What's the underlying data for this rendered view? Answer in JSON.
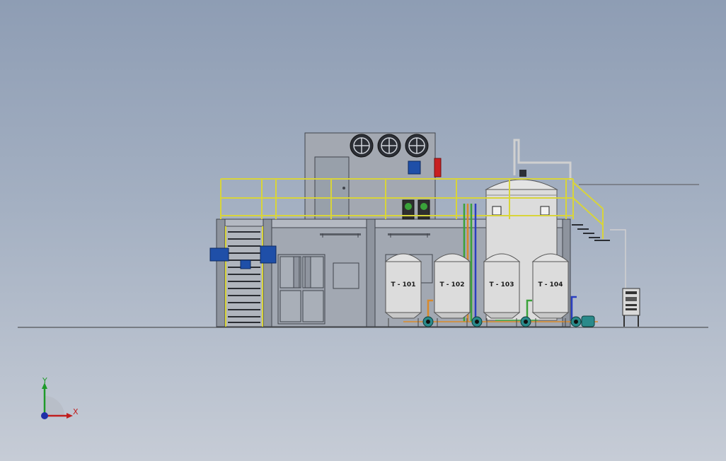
{
  "tanks": [
    {
      "label": "T - 101"
    },
    {
      "label": "T - 102"
    },
    {
      "label": "T - 103"
    },
    {
      "label": "T - 104"
    }
  ],
  "triad": {
    "x_label": "X",
    "y_label": "Y"
  },
  "colors": {
    "background_top": "#8e9db4",
    "background_bottom": "#c6ccd6",
    "railing": "#d8d43a",
    "structure": "#9aa0aa",
    "tank_body": "#dcdcdc",
    "pump": "#2a8a8a",
    "panel_blue": "#1f4fa8",
    "pipe_blue": "#2a3ec0",
    "pipe_green": "#3aa23a",
    "pipe_orange": "#d98a2a",
    "alarm_red": "#c82020"
  }
}
